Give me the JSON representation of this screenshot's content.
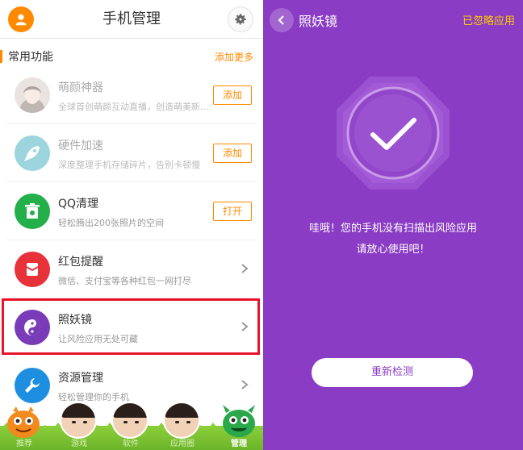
{
  "left": {
    "header": {
      "title": "手机管理"
    },
    "section": {
      "title": "常用功能",
      "more_label": "添加更多"
    },
    "rows": [
      {
        "name": "萌颜神器",
        "desc": "全球首创萌颜互动直播，创造萌美新...",
        "action": "添加",
        "icon": "face-avatar-icon"
      },
      {
        "name": "硬件加速",
        "desc": "深度整理手机存储碎片，告别卡顿慢",
        "action": "添加",
        "icon": "rocket-icon"
      },
      {
        "name": "QQ清理",
        "desc": "轻松腾出200张照片的空间",
        "action": "打开",
        "icon": "trash-icon"
      },
      {
        "name": "红包提醒",
        "desc": "微信、支付宝等各种红包一网打尽",
        "action": "",
        "icon": "red-packet-icon"
      },
      {
        "name": "照妖镜",
        "desc": "让风险应用无处可藏",
        "action": "",
        "icon": "yin-yang-icon"
      },
      {
        "name": "资源管理",
        "desc": "轻松管理你的手机",
        "action": "",
        "icon": "wrench-icon"
      }
    ],
    "bottom_nav": [
      {
        "label": "推荐"
      },
      {
        "label": "游戏"
      },
      {
        "label": "软件"
      },
      {
        "label": "应用圈"
      },
      {
        "label": "管理"
      }
    ]
  },
  "right": {
    "title": "照妖镜",
    "ignored_link": "已忽略应用",
    "message_line1": "哇哦！您的手机没有扫描出风险应用",
    "message_line2": "请放心使用吧！",
    "recheck_label": "重新检测"
  },
  "colors": {
    "accent": "#ff8a00",
    "purple": "#8a3cc4",
    "highlight": "#e8142a",
    "link_yellow": "#ffcc00"
  }
}
